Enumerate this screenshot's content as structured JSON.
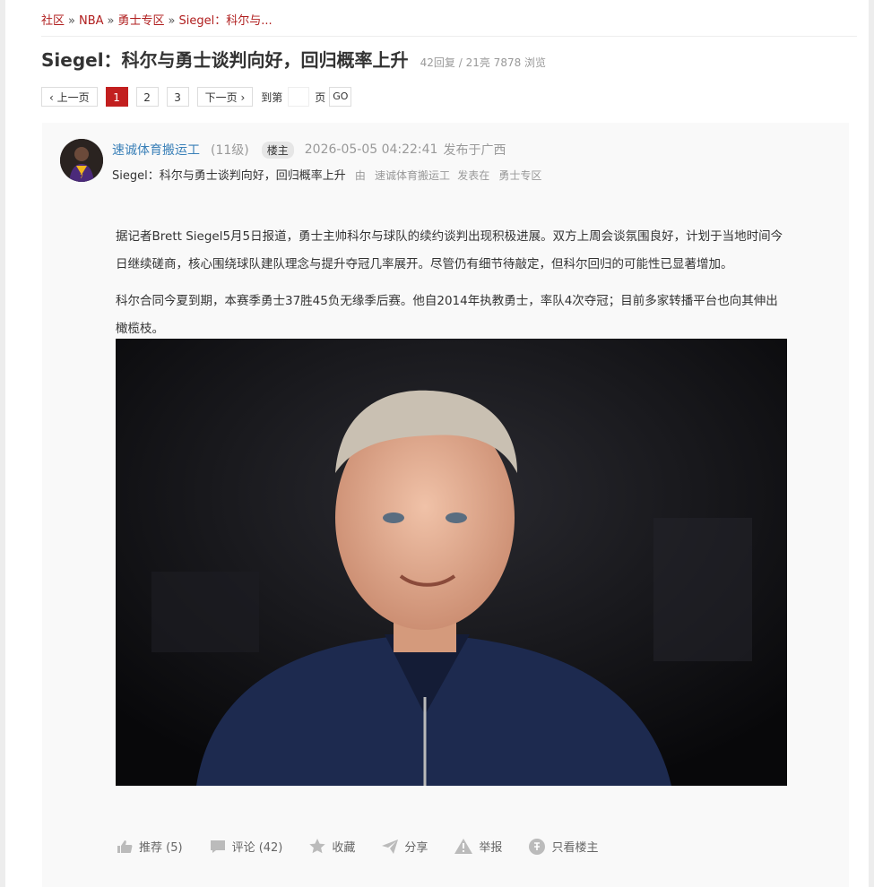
{
  "breadcrumb": {
    "items": [
      "社区",
      "NBA",
      "勇士专区",
      "Siegel：科尔与..."
    ],
    "separator": "»"
  },
  "thread": {
    "title": "Siegel：科尔与勇士谈判向好，回归概率上升",
    "stats": "42回复 / 21亮 7878 浏览"
  },
  "pager": {
    "prev": "‹ 上一页",
    "pages": [
      "1",
      "2",
      "3"
    ],
    "current": "1",
    "next": "下一页 ›",
    "goto_prefix": "到第",
    "goto_suffix": "页",
    "go": "GO"
  },
  "post": {
    "author": "速诚体育搬运工",
    "level": "(11级)",
    "role_badge": "楼主",
    "datetime": "2026-05-05 04:22:41",
    "location": "发布于广西",
    "subtitle": "Siegel：科尔与勇士谈判向好，回归概率上升",
    "by_prefix": "由",
    "by_author": "速诚体育搬运工",
    "posted_in": "发表在",
    "forum": "勇士专区",
    "paragraphs": [
      "据记者Brett Siegel5月5日报道，勇士主帅科尔与球队的续约谈判出现积极进展。双方上周会谈氛围良好，计划于当地时间今日继续磋商，核心围绕球队建队理念与提升夺冠几率展开。尽管仍有细节待敲定，但科尔回归的可能性已显著增加。",
      "科尔合同今夏到期，本赛季勇士37胜45负无缘季后赛。他自2014年执教勇士，率队4次夺冠；目前多家转播平台也向其伸出橄榄枝。"
    ]
  },
  "actions": {
    "recommend": "推荐 (5)",
    "comment": "评论 (42)",
    "favorite": "收藏",
    "share": "分享",
    "report": "举报",
    "only_author": "只看楼主"
  },
  "colors": {
    "accent": "#c21f1f",
    "link_red": "#b01e1e",
    "author_blue": "#3a80b8",
    "muted": "#999999"
  }
}
